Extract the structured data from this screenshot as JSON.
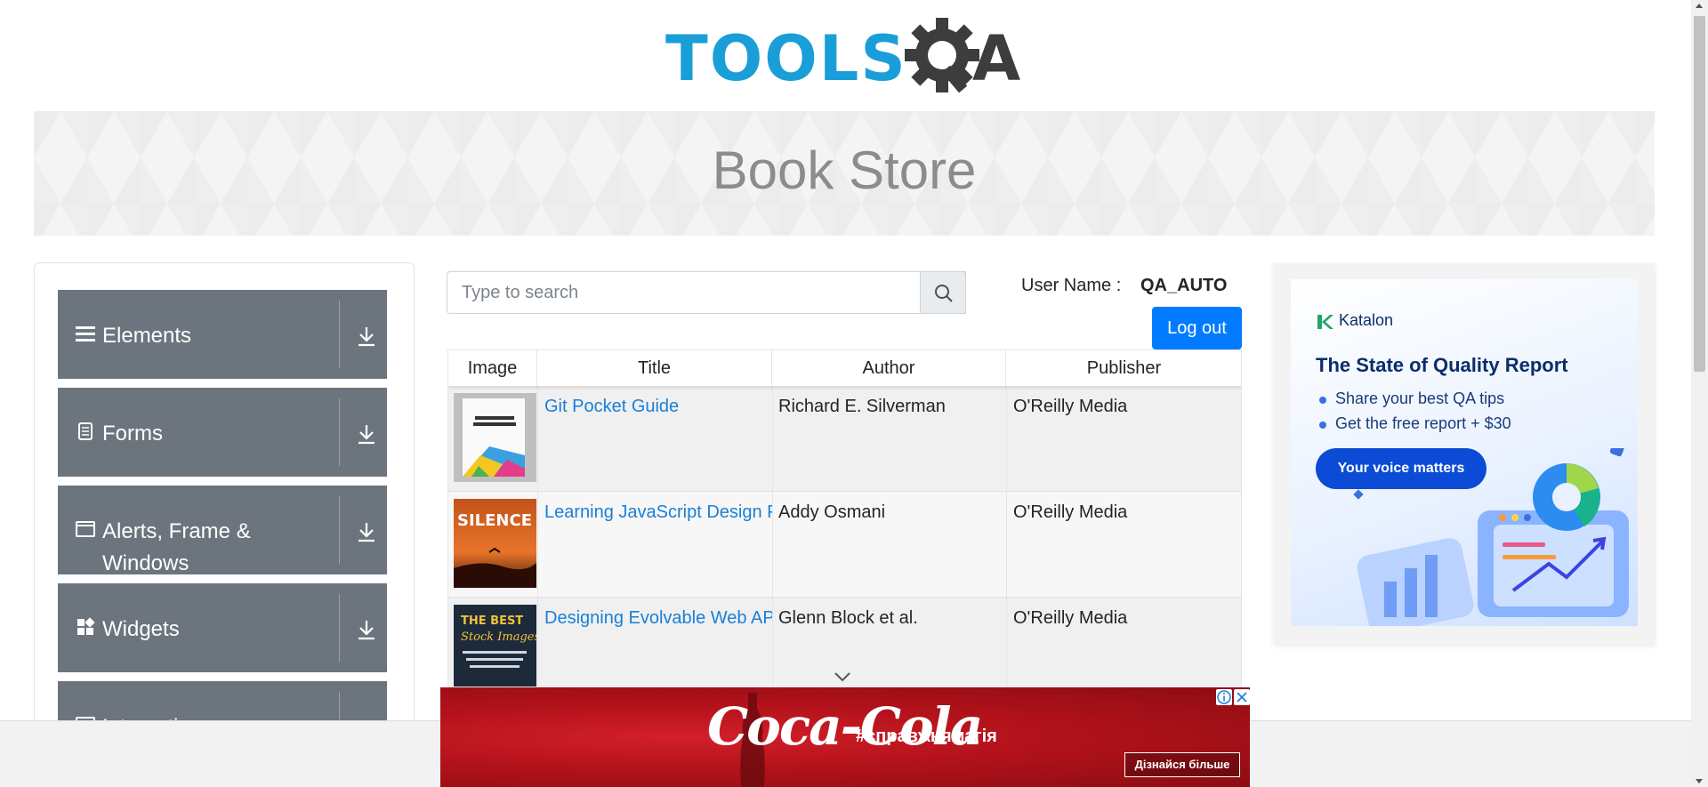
{
  "header": {
    "logo_text_left": "TOOLS",
    "logo_text_right": "A",
    "colors": {
      "logo_blue": "#1a9ed8",
      "logo_dark": "#3d3d3d"
    }
  },
  "banner": {
    "title": "Book Store"
  },
  "sidebar": {
    "groups": [
      {
        "label": "Elements",
        "icon": "hamburger-icon"
      },
      {
        "label": "Forms",
        "icon": "document-icon"
      },
      {
        "label": "Alerts, Frame & Windows",
        "icon": "window-icon"
      },
      {
        "label": "Widgets",
        "icon": "widgets-icon"
      },
      {
        "label": "Interactions",
        "icon": "interactions-icon"
      }
    ],
    "toggle_icon": "download-arrow-icon"
  },
  "search": {
    "placeholder": "Type to search",
    "value": "",
    "button_icon": "search-icon"
  },
  "user": {
    "label": "User Name :",
    "value": "QA_AUTO"
  },
  "logout": {
    "label": "Log out"
  },
  "table": {
    "columns": [
      "Image",
      "Title",
      "Author",
      "Publisher"
    ],
    "rows": [
      {
        "cover": "business-design-cover",
        "title": "Git Pocket Guide",
        "author": "Richard E. Silverman",
        "publisher": "O'Reilly Media"
      },
      {
        "cover": "silence-cover",
        "title": "Learning JavaScript Design Patterns",
        "author": "Addy Osmani",
        "publisher": "O'Reilly Media"
      },
      {
        "cover": "stock-images-cover",
        "title": "Designing Evolvable Web APIs with ASP.NET",
        "author": "Glenn Block et al.",
        "publisher": "O'Reilly Media"
      }
    ]
  },
  "right_ad": {
    "brand": "Katalon",
    "title": "The State of Quality Report",
    "bullets": [
      "Share your best QA tips",
      "Get the free report + $30"
    ],
    "cta": "Your voice matters"
  },
  "bottom_ad": {
    "brand": "Coca-Cola",
    "hashtag": "#справжнямагія",
    "button": "Дізнайся більше"
  },
  "colors": {
    "primary": "#007bff",
    "sidebar_group": "#6c757d",
    "link": "#1a7fd6"
  }
}
